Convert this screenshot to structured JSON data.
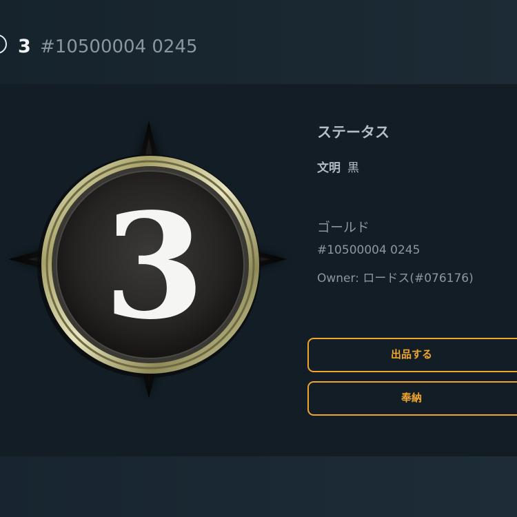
{
  "header": {
    "number": "3",
    "token_id": "#10500004 0245"
  },
  "emblem": {
    "numeral": "3"
  },
  "status": {
    "title": "ステータス",
    "civilization_label": "文明",
    "civilization_value": "黒",
    "rarity_label": "ゴールド",
    "token_id": "#10500004 0245",
    "owner": "Owner: ロードス(#076176)"
  },
  "actions": {
    "sell_label": "出品する",
    "offer_label": "奉納"
  },
  "colors": {
    "accent": "#f0a52e",
    "background": "#121d25"
  }
}
